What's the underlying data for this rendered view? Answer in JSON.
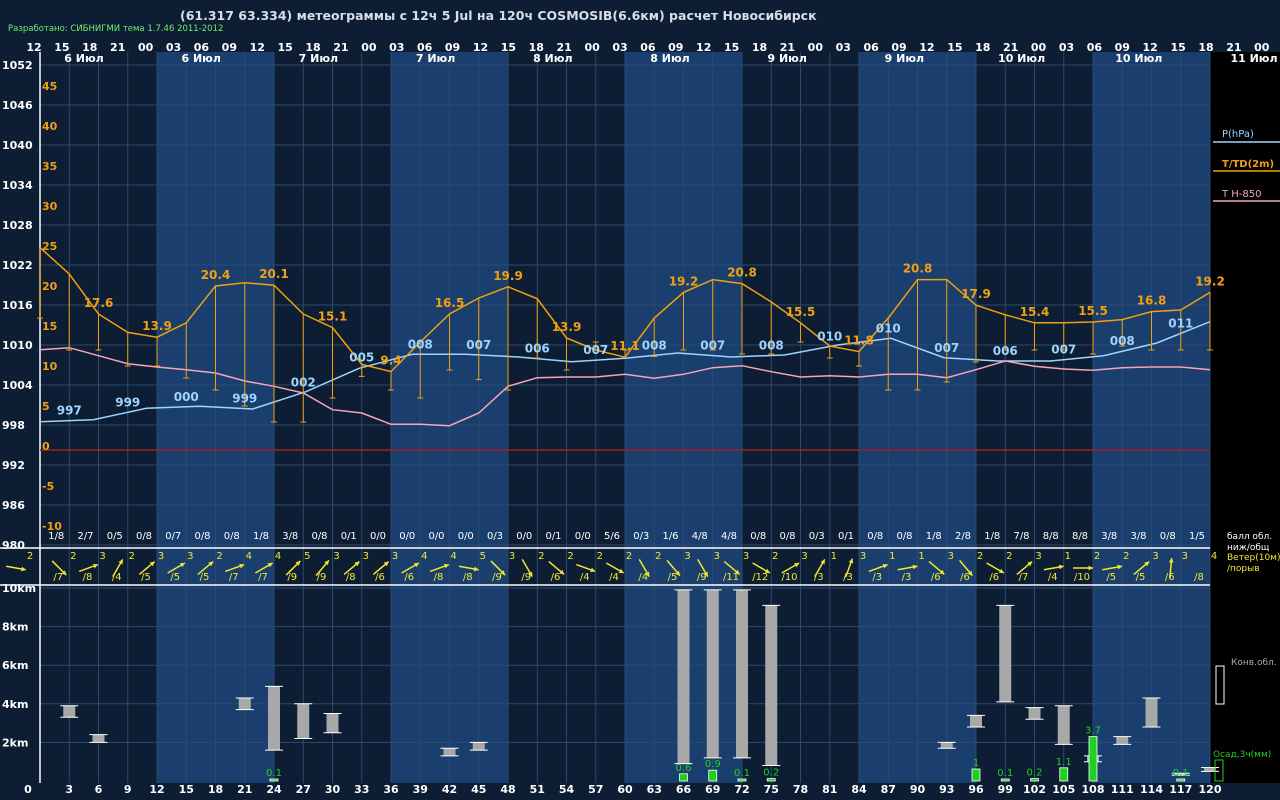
{
  "header": {
    "title": "(61.317 63.334) метеограммы с  12ч 5 Jul на 120ч COSMOSIB(6.6км) расчет Новосибирск",
    "credit": "Разработано: СИБНИГМИ тема 1.7.46 2011-2012"
  },
  "chart_data": {
    "type": "line",
    "time_hours_top": [
      "12",
      "15",
      "18",
      "21",
      "00",
      "03",
      "06",
      "09",
      "12",
      "15",
      "18",
      "21",
      "00",
      "03",
      "06",
      "09",
      "12",
      "15",
      "18",
      "21",
      "00",
      "03",
      "06",
      "09",
      "12",
      "15",
      "18",
      "21",
      "00",
      "03",
      "06",
      "09",
      "12",
      "15",
      "18",
      "21",
      "00",
      "03",
      "06",
      "09",
      "12",
      "15",
      "18",
      "21",
      "00",
      "03",
      "06",
      "09",
      "12"
    ],
    "day_labels": [
      "6 Июл",
      "6 Июл",
      "7 Июл",
      "7 Июл",
      "8 Июл",
      "8 Июл",
      "9 Июл",
      "9 Июл",
      "10 Июл",
      "10 Июл",
      "11 Июл"
    ],
    "pressure_axis": {
      "label": "P(hPa)",
      "ticks": [
        "1052",
        "1046",
        "1040",
        "1034",
        "1028",
        "1022",
        "1016",
        "1010",
        "1004",
        "998",
        "992",
        "986",
        "980"
      ],
      "range": [
        980,
        1052
      ]
    },
    "temperature_axis": {
      "label": "T/TD(2m)",
      "ticks": [
        "45",
        "40",
        "35",
        "30",
        "25",
        "20",
        "15",
        "10",
        "5",
        "0",
        "-5",
        "-10"
      ],
      "range": [
        -12,
        48
      ]
    },
    "t850_label": "T H-850",
    "pressure_series": [
      998.5,
      998.8,
      1000.5,
      1000.8,
      1000.4,
      1003,
      1006.5,
      1008.6,
      1008.6,
      1008.2,
      1007.5,
      1008.0,
      1008.8,
      1008.2,
      1008.5,
      1010,
      1011,
      1008.1,
      1007.6,
      1007.6,
      1008.4,
      1010.3,
      1013.5
    ],
    "pressure_labels": [
      {
        "i": 1,
        "t": "997"
      },
      {
        "i": 3,
        "t": "999"
      },
      {
        "i": 5,
        "t": "000"
      },
      {
        "i": 7,
        "t": "999"
      },
      {
        "i": 9,
        "t": "002"
      },
      {
        "i": 11,
        "t": "005"
      },
      {
        "i": 13,
        "t": "008"
      },
      {
        "i": 15,
        "t": "007"
      },
      {
        "i": 17,
        "t": "006"
      },
      {
        "i": 19,
        "t": "007"
      },
      {
        "i": 21,
        "t": "008"
      },
      {
        "i": 23,
        "t": "007"
      },
      {
        "i": 25,
        "t": "008"
      },
      {
        "i": 27,
        "t": "010"
      },
      {
        "i": 29,
        "t": "010"
      },
      {
        "i": 31,
        "t": "007"
      },
      {
        "i": 33,
        "t": "006"
      },
      {
        "i": 35,
        "t": "007"
      },
      {
        "i": 37,
        "t": "008"
      },
      {
        "i": 39,
        "t": "011"
      }
    ],
    "temperature_series": [
      24.8,
      21.5,
      16.5,
      14.2,
      13.6,
      15.4,
      20,
      20.4,
      20.1,
      16.5,
      14.8,
      10.2,
      9.3,
      13,
      16.5,
      18.5,
      19.9,
      18.4,
      13.5,
      12,
      11.1,
      16,
      19.2,
      20.8,
      20.3,
      18,
      15.4,
      12.5,
      11.8,
      16,
      20.8,
      20.8,
      17.6,
      16.4,
      15.4,
      15.4,
      15.5,
      15.8,
      16.8,
      17,
      19.2
    ],
    "temperature_labels": [
      {
        "i": 2,
        "t": "17.6"
      },
      {
        "i": 4,
        "t": "13.9"
      },
      {
        "i": 6,
        "t": "20.4"
      },
      {
        "i": 8,
        "t": "20.1"
      },
      {
        "i": 10,
        "t": "15.1"
      },
      {
        "i": 12,
        "t": "9.4"
      },
      {
        "i": 14,
        "t": "16.5"
      },
      {
        "i": 16,
        "t": "19.9"
      },
      {
        "i": 18,
        "t": "13.9"
      },
      {
        "i": 20,
        "t": "11.1"
      },
      {
        "i": 22,
        "t": "19.2"
      },
      {
        "i": 24,
        "t": "20.8"
      },
      {
        "i": 26,
        "t": "15.5"
      },
      {
        "i": 28,
        "t": "11.8"
      },
      {
        "i": 30,
        "t": "20.8"
      },
      {
        "i": 32,
        "t": "17.9"
      },
      {
        "i": 34,
        "t": "15.4"
      },
      {
        "i": 36,
        "t": "15.5"
      },
      {
        "i": 38,
        "t": "16.8"
      },
      {
        "i": 40,
        "t": "19.2"
      }
    ],
    "dewpoint_series": [
      16,
      12,
      12,
      10,
      10,
      8.5,
      7,
      5,
      3,
      3,
      6,
      8.7,
      7,
      6,
      9.5,
      8.3,
      7,
      11,
      9.5,
      13,
      12,
      11.2,
      12,
      12,
      11.5,
      11.5,
      13,
      11,
      10,
      7,
      7,
      8,
      10.5,
      12,
      12,
      12,
      11.5,
      12.5,
      12,
      12,
      12
    ],
    "t850_series": [
      1009.3,
      1009.6,
      1008.4,
      1007.2,
      1006.7,
      1006.3,
      1005.8,
      1004.6,
      1003.8,
      1002.8,
      1000.3,
      999.8,
      998.1,
      998.1,
      997.9,
      999.8,
      1003.8,
      1005.1,
      1005.2,
      1005.2,
      1005.6,
      1005.0,
      1005.6,
      1006.6,
      1006.9,
      1006.0,
      1005.2,
      1005.4,
      1005.2,
      1005.6,
      1005.6,
      1005.1,
      1006.3,
      1007.6,
      1006.8,
      1006.4,
      1006.2,
      1006.6,
      1006.7,
      1006.7,
      1006.3
    ],
    "cloud_cover": [
      "1/8",
      "2/7",
      "0/5",
      "0/8",
      "0/7",
      "0/8",
      "0/8",
      "1/8",
      "3/8",
      "0/8",
      "0/1",
      "0/0",
      "0/0",
      "0/0",
      "0/0",
      "0/3",
      "0/0",
      "0/1",
      "0/0",
      "5/6",
      "0/3",
      "1/6",
      "4/8",
      "4/8",
      "0/8",
      "0/8",
      "0/3",
      "0/1",
      "0/8",
      "0/8",
      "1/8",
      "2/8",
      "1/8",
      "7/8",
      "8/8",
      "8/8",
      "3/8",
      "3/8",
      "0/8",
      "1/5"
    ],
    "cloud_legend": "балл обл. ниж/общ",
    "wind_legend": "Ветер(10м) /порыв",
    "wind_speed": [
      "2",
      "2",
      "3",
      "2",
      "3",
      "3",
      "2",
      "4",
      "4",
      "5",
      "3",
      "3",
      "3",
      "4",
      "4",
      "5",
      "3",
      "2",
      "2",
      "2",
      "2",
      "2",
      "3",
      "3",
      "3",
      "2",
      "3",
      "1",
      "3",
      "1",
      "1",
      "3",
      "2",
      "2",
      "3",
      "1",
      "2",
      "2",
      "3",
      "3",
      "4"
    ],
    "wind_gust": [
      "/7",
      "/8",
      "/4",
      "/5",
      "/5",
      "/5",
      "/7",
      "/7",
      "/9",
      "/9",
      "/8",
      "/6",
      "/6",
      "/8",
      "/8",
      "/9",
      "/9",
      "/6",
      "/4",
      "/4",
      "/4",
      "/5",
      "/9",
      "/11",
      "/12",
      "/10",
      "/3",
      "/3",
      "/3",
      "/3",
      "/6",
      "/6",
      "/6",
      "/7",
      "/4",
      "/10",
      "/5",
      "/5",
      "/6",
      "/8"
    ],
    "wind_dir_deg": [
      80,
      45,
      110,
      150,
      130,
      120,
      130,
      110,
      120,
      135,
      140,
      130,
      130,
      120,
      110,
      80,
      45,
      30,
      50,
      70,
      60,
      30,
      40,
      30,
      50,
      60,
      120,
      150,
      160,
      110,
      100,
      50,
      40,
      60,
      130,
      100,
      90,
      100,
      130,
      175
    ],
    "height_axis": {
      "ticks": [
        "10km",
        "8km",
        "6km",
        "4km",
        "2km"
      ],
      "range": [
        0,
        11
      ]
    },
    "forecast_hours": [
      "0",
      "3",
      "6",
      "9",
      "12",
      "15",
      "18",
      "21",
      "24",
      "27",
      "30",
      "33",
      "36",
      "39",
      "42",
      "45",
      "48",
      "51",
      "54",
      "57",
      "60",
      "63",
      "66",
      "69",
      "72",
      "75",
      "78",
      "81",
      "84",
      "87",
      "90",
      "93",
      "96",
      "99",
      "102",
      "105",
      "108",
      "111",
      "114",
      "117",
      "120"
    ],
    "conv_legend": "Конв.обл.",
    "precip_legend": "Осад,3ч(мм)",
    "clouds": [
      {
        "h": 3,
        "b": 3.3,
        "t": 3.9
      },
      {
        "h": 6,
        "b": 2.0,
        "t": 2.4
      },
      {
        "h": 21,
        "b": 3.7,
        "t": 4.3
      },
      {
        "h": 24,
        "b": 1.6,
        "t": 4.9
      },
      {
        "h": 27,
        "b": 2.2,
        "t": 4.0
      },
      {
        "h": 30,
        "b": 2.5,
        "t": 3.5
      },
      {
        "h": 42,
        "b": 1.3,
        "t": 1.7
      },
      {
        "h": 45,
        "b": 1.6,
        "t": 2.0
      },
      {
        "h": 66,
        "b": 0.9,
        "t": 9.9
      },
      {
        "h": 69,
        "b": 1.2,
        "t": 9.9
      },
      {
        "h": 72,
        "b": 1.2,
        "t": 9.9
      },
      {
        "h": 75,
        "b": 0.8,
        "t": 9.1
      },
      {
        "h": 93,
        "b": 1.7,
        "t": 2.0
      },
      {
        "h": 96,
        "b": 2.8,
        "t": 3.4
      },
      {
        "h": 99,
        "b": 4.1,
        "t": 9.1
      },
      {
        "h": 102,
        "b": 3.2,
        "t": 3.8
      },
      {
        "h": 105,
        "b": 1.9,
        "t": 3.9
      },
      {
        "h": 108,
        "b": 1.0,
        "t": 1.3
      },
      {
        "h": 111,
        "b": 1.9,
        "t": 2.3
      },
      {
        "h": 114,
        "b": 2.8,
        "t": 4.3
      },
      {
        "h": 117,
        "b": 0.3,
        "t": 0.4
      },
      {
        "h": 120,
        "b": 0.5,
        "t": 0.7
      }
    ],
    "precip": [
      {
        "h": 24,
        "v": 0.1,
        "label": "0.1"
      },
      {
        "h": 66,
        "v": 0.6,
        "label": "0.6"
      },
      {
        "h": 69,
        "v": 0.9,
        "label": "0.9"
      },
      {
        "h": 72,
        "v": 0.1,
        "label": "0.1"
      },
      {
        "h": 75,
        "v": 0.2,
        "label": "0.2"
      },
      {
        "h": 96,
        "v": 1,
        "label": "1"
      },
      {
        "h": 99,
        "v": 0.1,
        "label": "0.1"
      },
      {
        "h": 102,
        "v": 0.2,
        "label": "0.2"
      },
      {
        "h": 105,
        "v": 1.1,
        "label": "1.1"
      },
      {
        "h": 108,
        "v": 3.7,
        "label": "3.7"
      },
      {
        "h": 117,
        "v": 0.1,
        "label": "0.1"
      }
    ],
    "colors": {
      "background": "#0d1d33",
      "band": "#1a3f6e",
      "pressure": "#9fd4ff",
      "temperature": "#f0a010",
      "t850": "#f4a6b8",
      "wind": "#f0e830",
      "precip": "#20d020",
      "cloud": "#a8a8a8"
    }
  }
}
